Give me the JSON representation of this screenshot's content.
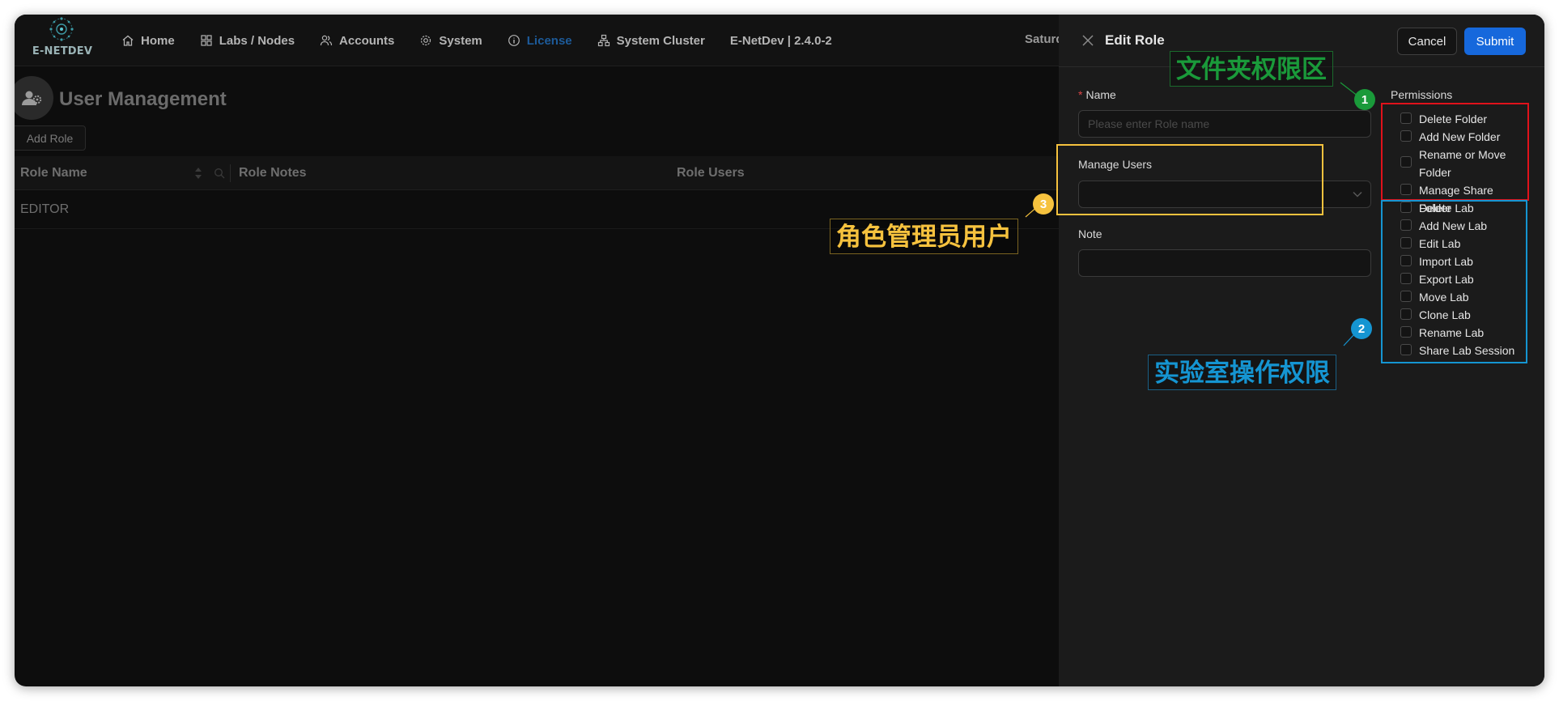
{
  "app": {
    "logo_text": "E-NETDEV",
    "version": "E-NetDev | 2.4.0-2",
    "date_fragment": "Saturd"
  },
  "nav": [
    {
      "label": "Home",
      "icon": "home-icon"
    },
    {
      "label": "Labs / Nodes",
      "icon": "grid-icon"
    },
    {
      "label": "Accounts",
      "icon": "users-icon"
    },
    {
      "label": "System",
      "icon": "gear-icon"
    },
    {
      "label": "License",
      "icon": "info-icon",
      "active": true
    },
    {
      "label": "System Cluster",
      "icon": "cluster-icon"
    }
  ],
  "page": {
    "title": "User Management",
    "add_role_label": "Add Role"
  },
  "table": {
    "columns": [
      "Role Name",
      "Role Notes",
      "Role Users"
    ],
    "rows": [
      {
        "role_name": "EDITOR",
        "role_notes": "",
        "role_users": ""
      }
    ]
  },
  "drawer": {
    "title": "Edit Role",
    "cancel_label": "Cancel",
    "submit_label": "Submit",
    "name_label": "Name",
    "name_placeholder": "Please enter Role name",
    "manage_users_label": "Manage Users",
    "note_label": "Note",
    "permissions_label": "Permissions",
    "permissions": [
      "Delete Folder",
      "Add New Folder",
      "Rename or Move Folder",
      "Manage Share Folder",
      "Delete Lab",
      "Add New Lab",
      "Edit Lab",
      "Import Lab",
      "Export Lab",
      "Move Lab",
      "Clone Lab",
      "Rename Lab",
      "Share Lab Session"
    ]
  },
  "annotations": [
    {
      "number": "1",
      "text": "文件夹权限区",
      "color": "#1a9a3a",
      "box_color": "#e0121b"
    },
    {
      "number": "2",
      "text": "实验室操作权限",
      "color": "#1595d2",
      "box_color": "#1595d2"
    },
    {
      "number": "3",
      "text": "角色管理员用户",
      "color": "#f6c23e",
      "box_color": "#f6c23e"
    }
  ],
  "colors": {
    "accent": "#1668dc",
    "active_nav": "#1d5b9a",
    "background": "#0d0d0d",
    "drawer": "#1b1b1b"
  }
}
